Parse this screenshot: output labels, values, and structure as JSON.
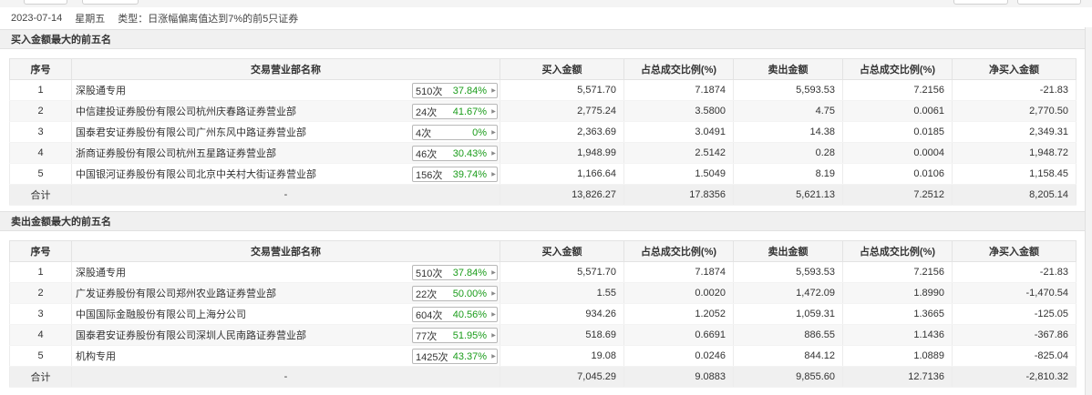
{
  "info": {
    "date": "2023-07-14",
    "weekday": "星期五",
    "type_label": "类型：",
    "type_value": "日涨幅偏离值达到7%的前5只证券"
  },
  "buy_section": {
    "title": "买入金额最大的前五名",
    "headers": [
      "序号",
      "交易营业部名称",
      "买入金额",
      "占总成交比例(%)",
      "卖出金额",
      "占总成交比例(%)",
      "净买入金额"
    ],
    "rows": [
      {
        "idx": "1",
        "name": "深股通专用",
        "count": "510次",
        "rate": "37.84%",
        "buy": "5,571.70",
        "buy_pct": "7.1874",
        "sell": "5,593.53",
        "sell_pct": "7.2156",
        "net": "-21.83"
      },
      {
        "idx": "2",
        "name": "中信建投证券股份有限公司杭州庆春路证券营业部",
        "count": "24次",
        "rate": "41.67%",
        "buy": "2,775.24",
        "buy_pct": "3.5800",
        "sell": "4.75",
        "sell_pct": "0.0061",
        "net": "2,770.50"
      },
      {
        "idx": "3",
        "name": "国泰君安证券股份有限公司广州东风中路证券营业部",
        "count": "4次",
        "rate": "0%",
        "buy": "2,363.69",
        "buy_pct": "3.0491",
        "sell": "14.38",
        "sell_pct": "0.0185",
        "net": "2,349.31"
      },
      {
        "idx": "4",
        "name": "浙商证券股份有限公司杭州五星路证券营业部",
        "count": "46次",
        "rate": "30.43%",
        "buy": "1,948.99",
        "buy_pct": "2.5142",
        "sell": "0.28",
        "sell_pct": "0.0004",
        "net": "1,948.72"
      },
      {
        "idx": "5",
        "name": "中国银河证券股份有限公司北京中关村大街证券营业部",
        "count": "156次",
        "rate": "39.74%",
        "buy": "1,166.64",
        "buy_pct": "1.5049",
        "sell": "8.19",
        "sell_pct": "0.0106",
        "net": "1,158.45"
      }
    ],
    "total": {
      "label": "合计",
      "name": "-",
      "buy": "13,826.27",
      "buy_pct": "17.8356",
      "sell": "5,621.13",
      "sell_pct": "7.2512",
      "net": "8,205.14"
    }
  },
  "sell_section": {
    "title": "卖出金额最大的前五名",
    "headers": [
      "序号",
      "交易营业部名称",
      "买入金额",
      "占总成交比例(%)",
      "卖出金额",
      "占总成交比例(%)",
      "净买入金额"
    ],
    "rows": [
      {
        "idx": "1",
        "name": "深股通专用",
        "count": "510次",
        "rate": "37.84%",
        "buy": "5,571.70",
        "buy_pct": "7.1874",
        "sell": "5,593.53",
        "sell_pct": "7.2156",
        "net": "-21.83"
      },
      {
        "idx": "2",
        "name": "广发证券股份有限公司郑州农业路证券营业部",
        "count": "22次",
        "rate": "50.00%",
        "buy": "1.55",
        "buy_pct": "0.0020",
        "sell": "1,472.09",
        "sell_pct": "1.8990",
        "net": "-1,470.54"
      },
      {
        "idx": "3",
        "name": "中国国际金融股份有限公司上海分公司",
        "count": "604次",
        "rate": "40.56%",
        "buy": "934.26",
        "buy_pct": "1.2052",
        "sell": "1,059.31",
        "sell_pct": "1.3665",
        "net": "-125.05"
      },
      {
        "idx": "4",
        "name": "国泰君安证券股份有限公司深圳人民南路证券营业部",
        "count": "77次",
        "rate": "51.95%",
        "buy": "518.69",
        "buy_pct": "0.6691",
        "sell": "886.55",
        "sell_pct": "1.1436",
        "net": "-367.86"
      },
      {
        "idx": "5",
        "name": "机构专用",
        "count": "1425次",
        "rate": "43.37%",
        "buy": "19.08",
        "buy_pct": "0.0246",
        "sell": "844.12",
        "sell_pct": "1.0889",
        "net": "-825.04"
      }
    ],
    "total": {
      "label": "合计",
      "name": "-",
      "buy": "7,045.29",
      "buy_pct": "9.0883",
      "sell": "9,855.60",
      "sell_pct": "12.7136",
      "net": "-2,810.32"
    }
  },
  "colors": {
    "positive": "#e4393c",
    "negative": "#1a9c1a",
    "header_bg": "#f0f0f0"
  }
}
